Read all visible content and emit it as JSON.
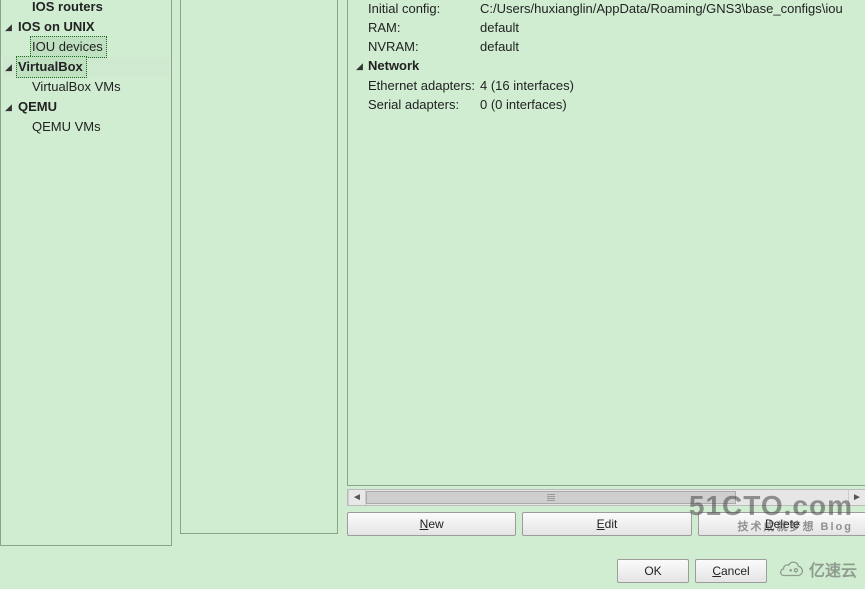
{
  "tree": {
    "items": [
      {
        "label": "IOS routers",
        "root": false,
        "bold": true,
        "expander": "none",
        "selected": false
      },
      {
        "label": "IOS on UNIX",
        "root": true,
        "bold": true,
        "expander": "open",
        "selected": false
      },
      {
        "label": "IOU devices",
        "root": false,
        "bold": false,
        "expander": "none",
        "selected": true
      },
      {
        "label": "VirtualBox",
        "root": true,
        "bold": true,
        "expander": "open",
        "selected": false,
        "highlight": true
      },
      {
        "label": "VirtualBox VMs",
        "root": false,
        "bold": false,
        "expander": "none",
        "selected": false
      },
      {
        "label": "QEMU",
        "root": true,
        "bold": true,
        "expander": "open",
        "selected": false
      },
      {
        "label": "QEMU VMs",
        "root": false,
        "bold": false,
        "expander": "none",
        "selected": false
      }
    ]
  },
  "details": {
    "general_rows": [
      {
        "key": "Initial config:",
        "value": "C:/Users/huxianglin/AppData/Roaming/GNS3\\base_configs\\iou"
      },
      {
        "key": "RAM:",
        "value": "default"
      },
      {
        "key": "NVRAM:",
        "value": "default"
      }
    ],
    "network_header": "Network",
    "network_rows": [
      {
        "key": "Ethernet adapters:",
        "value": "4 (16 interfaces)"
      },
      {
        "key": "Serial adapters:",
        "value": "0 (0 interfaces)"
      }
    ]
  },
  "buttons": {
    "new": {
      "ul": "N",
      "rest": "ew"
    },
    "edit": {
      "ul": "E",
      "rest": "dit"
    },
    "delete": {
      "ul": "D",
      "rest": "elete"
    },
    "ok": "OK",
    "cancel": {
      "ul": "C",
      "rest": "ancel"
    }
  },
  "watermarks": {
    "cto_main": "51CTO.com",
    "cto_sub": "技术成就梦想   Blog",
    "ysy": "亿速云"
  }
}
